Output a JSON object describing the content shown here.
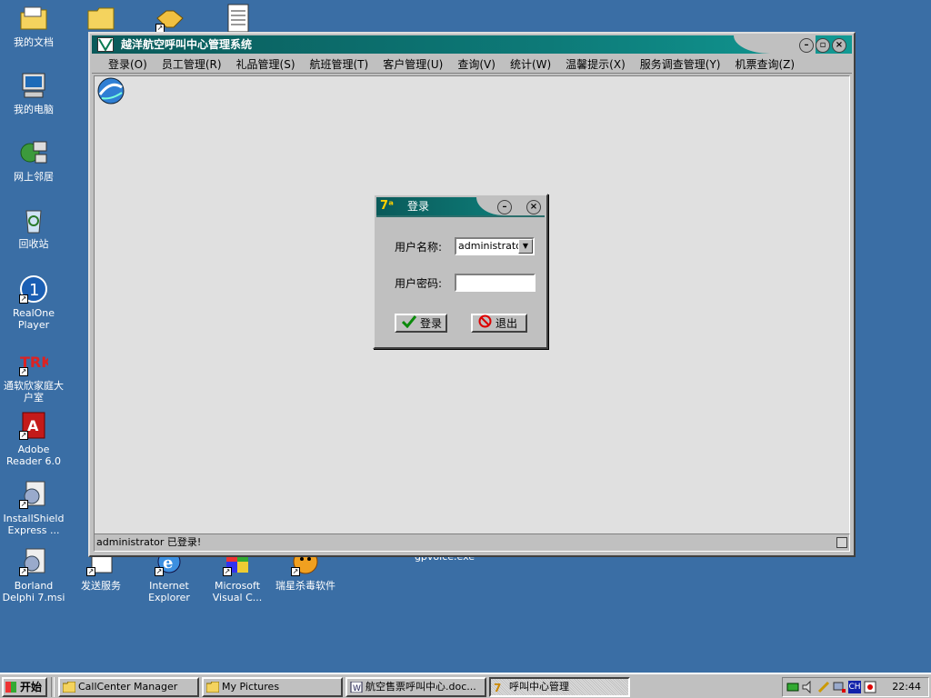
{
  "desktop": {
    "icons": [
      {
        "label": "我的文档"
      },
      {
        "label": "我的电脑"
      },
      {
        "label": "网上邻居"
      },
      {
        "label": "回收站"
      },
      {
        "label": "RealOne Player"
      },
      {
        "label": "通软欣家庭大户室"
      },
      {
        "label": "Adobe Reader 6.0"
      },
      {
        "label": "InstallShield Express ..."
      },
      {
        "label": "Borland Delphi 7.msi"
      },
      {
        "label": "发送服务"
      },
      {
        "label": "Internet Explorer"
      },
      {
        "label": "Microsoft Visual C..."
      },
      {
        "label": "瑞星杀毒软件"
      },
      {
        "label": "gpvoice.exe"
      }
    ]
  },
  "main_window": {
    "title": "越洋航空呼叫中心管理系统",
    "menu": [
      "登录(O)",
      "员工管理(R)",
      "礼品管理(S)",
      "航班管理(T)",
      "客户管理(U)",
      "查询(V)",
      "统计(W)",
      "温馨提示(X)",
      "服务调查管理(Y)",
      "机票查询(Z)"
    ],
    "status_text": "administrator 已登录!"
  },
  "login_dialog": {
    "title": "登录",
    "username_label": "用户名称:",
    "username_value": "administrator",
    "password_label": "用户密码:",
    "login_button": "登录",
    "exit_button": "退出"
  },
  "taskbar": {
    "start_label": "开始",
    "tasks": [
      {
        "label": "CallCenter Manager"
      },
      {
        "label": "My Pictures"
      },
      {
        "label": "航空售票呼叫中心.doc..."
      },
      {
        "label": "呼叫中心管理"
      }
    ],
    "tray_lang": "CH",
    "clock": "22:44"
  },
  "colors": {
    "desktop": "#3a6ea5",
    "titlebar": "#0d7a78",
    "face": "#c0c0c0"
  }
}
